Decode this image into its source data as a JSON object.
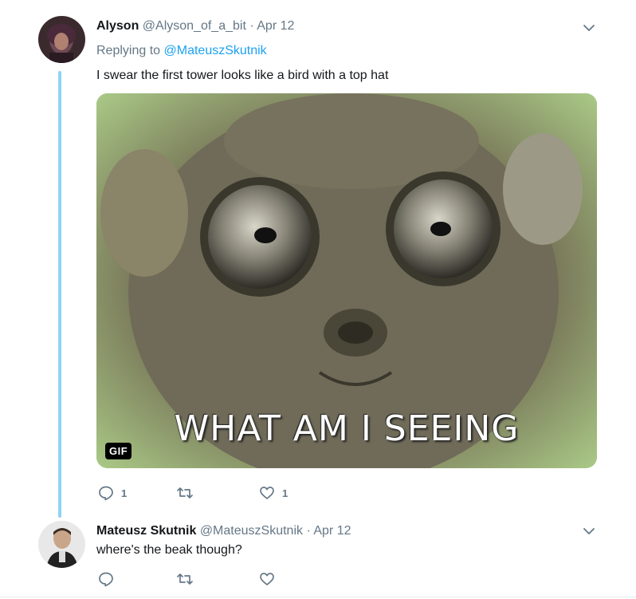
{
  "tweet1": {
    "name": "Alyson",
    "handle": "@Alyson_of_a_bit",
    "separator": "·",
    "time": "Apr 12",
    "replying_prefix": "Replying to",
    "replying_handle": "@MateuszSkutnik",
    "text": "I swear the first tower looks like a bird with a top hat",
    "gif_badge": "GIF",
    "gif_caption": "WHAT AM I SEEING",
    "reply_count": "1",
    "retweet_count": "",
    "like_count": "1"
  },
  "tweet2": {
    "name": "Mateusz Skutnik",
    "handle": "@MateuszSkutnik",
    "separator": "·",
    "time": "Apr 12",
    "text": "where's the beak though?"
  },
  "colors": {
    "accent": "#1da1f2",
    "thread_line": "#8fd3f6",
    "muted": "#657786",
    "text": "#14171a"
  }
}
